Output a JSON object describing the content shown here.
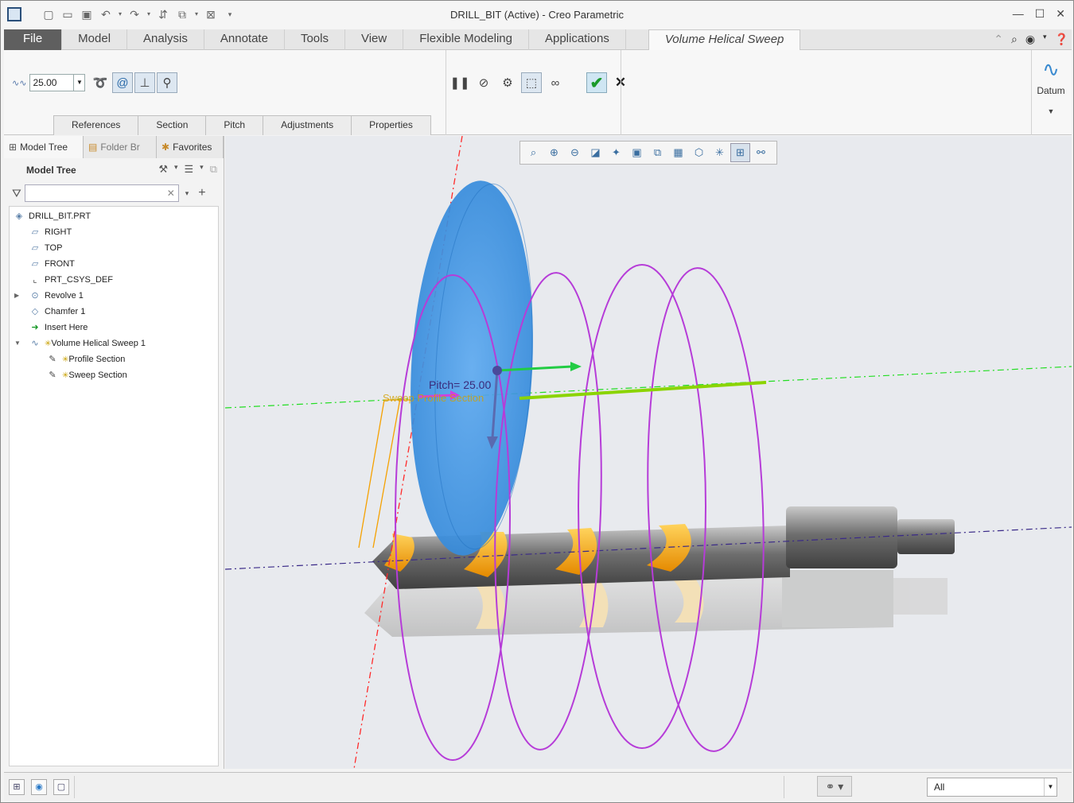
{
  "window": {
    "title": "DRILL_BIT (Active) - Creo Parametric",
    "minimize_icon": "minimize-icon",
    "maximize_icon": "maximize-icon",
    "close_icon": "close-icon"
  },
  "ribbon_tabs": [
    {
      "label": "File"
    },
    {
      "label": "Model"
    },
    {
      "label": "Analysis"
    },
    {
      "label": "Annotate"
    },
    {
      "label": "Tools"
    },
    {
      "label": "View"
    },
    {
      "label": "Flexible Modeling"
    },
    {
      "label": "Applications"
    },
    {
      "label": "Volume Helical Sweep"
    }
  ],
  "ribbon": {
    "pitch_value": "25.00",
    "sub_tabs": [
      "References",
      "Section",
      "Pitch",
      "Adjustments",
      "Properties"
    ],
    "datum_label": "Datum"
  },
  "left_panel": {
    "tabs": [
      "Model Tree",
      "Folder Br",
      "Favorites"
    ],
    "tree_title": "Model Tree",
    "filter_placeholder": ""
  },
  "model_tree": [
    {
      "label": "DRILL_BIT.PRT",
      "level": 0,
      "icon": "part-icon"
    },
    {
      "label": "RIGHT",
      "level": 1,
      "icon": "datum-plane-icon"
    },
    {
      "label": "TOP",
      "level": 1,
      "icon": "datum-plane-icon"
    },
    {
      "label": "FRONT",
      "level": 1,
      "icon": "datum-plane-icon"
    },
    {
      "label": "PRT_CSYS_DEF",
      "level": 1,
      "icon": "csys-icon"
    },
    {
      "label": "Revolve 1",
      "level": 1,
      "icon": "revolve-icon"
    },
    {
      "label": "Chamfer 1",
      "level": 1,
      "icon": "chamfer-icon"
    },
    {
      "label": "Insert Here",
      "level": 1,
      "icon": "insert-arrow-icon"
    },
    {
      "label": "Volume Helical Sweep 1",
      "level": 1,
      "icon": "helical-sweep-icon"
    },
    {
      "label": "Profile Section",
      "level": 2,
      "icon": "sketch-icon"
    },
    {
      "label": "Sweep Section",
      "level": 2,
      "icon": "sketch-icon"
    }
  ],
  "viewport": {
    "pitch_label": "Pitch= 25.00",
    "section_label": "Sweep Profile Section"
  },
  "status_bar": {
    "filter_value": "All"
  },
  "colors": {
    "file_tab": "#5f5f5f",
    "helix": "#b63cd8",
    "disk": "#3f97e6",
    "datum_axis": "#ff2a2a",
    "green_axis": "#22dd22",
    "flute": "#f5a100"
  }
}
